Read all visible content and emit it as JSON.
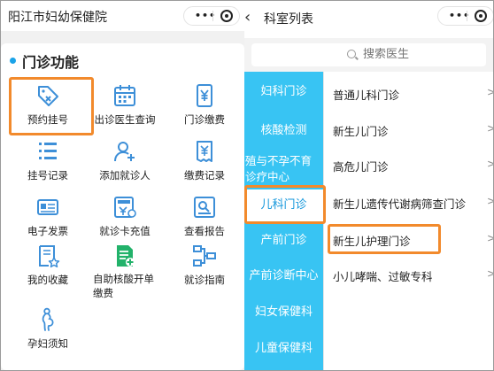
{
  "left": {
    "nav_title": "阳江市妇幼保健院",
    "capsule": {
      "more": "•••"
    },
    "section_title": "门诊功能",
    "features": [
      {
        "label": "预约挂号",
        "icon": "tag-cross-icon"
      },
      {
        "label": "出诊医生查询",
        "icon": "calendar-icon"
      },
      {
        "label": "门诊缴费",
        "icon": "yuan-phone-icon"
      },
      {
        "label": "挂号记录",
        "icon": "list-icon"
      },
      {
        "label": "添加就诊人",
        "icon": "add-person-icon"
      },
      {
        "label": "缴费记录",
        "icon": "receipt-icon"
      },
      {
        "label": "电子发票",
        "icon": "invoice-card-icon"
      },
      {
        "label": "就诊卡充值",
        "icon": "card-refill-icon"
      },
      {
        "label": "查看报告",
        "icon": "report-search-icon"
      },
      {
        "label": "我的收藏",
        "icon": "favorite-doc-icon"
      },
      {
        "label": "自助核酸开单缴费",
        "icon": "nucleic-doc-icon"
      },
      {
        "label": "就诊指南",
        "icon": "flow-guide-icon"
      },
      {
        "label": "孕妇须知",
        "icon": "pregnant-icon"
      }
    ]
  },
  "right": {
    "nav_back": "‹",
    "nav_title": "科室列表",
    "search_placeholder": "搜索医生",
    "departments": [
      "妇科门诊",
      "核酸检测",
      "殖与不孕不育诊疗中心",
      "儿科门诊",
      "产前门诊",
      "产前诊断中心",
      "妇女保健科",
      "儿童保健科"
    ],
    "clinics": [
      "普通儿科门诊",
      "新生儿门诊",
      "高危儿门诊",
      "新生儿遗传代谢病筛查门诊",
      "新生儿护理门诊",
      "小儿哮喘、过敏专科"
    ],
    "chevron": ">"
  },
  "colors": {
    "accent_blue": "#38c4f3",
    "active_text": "#1296db",
    "highlight_orange": "#f28a2c",
    "icon_blue": "#3d8fd8",
    "icon_green": "#22b26a"
  }
}
